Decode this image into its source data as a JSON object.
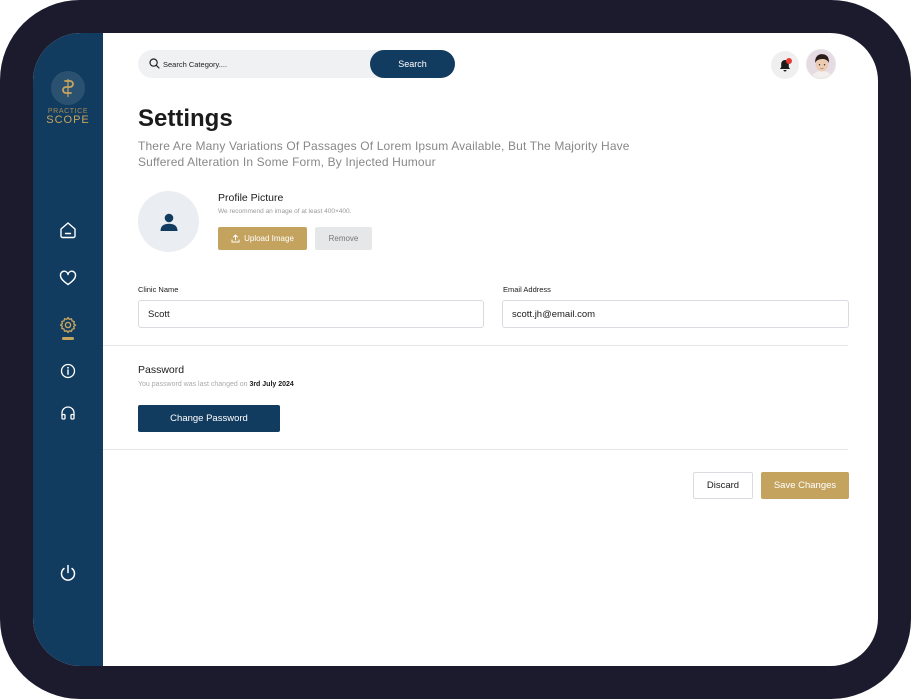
{
  "brand": {
    "line1": "PRACTICE",
    "line2": "SCOPE"
  },
  "sidebar": {
    "items": [
      {
        "name": "home",
        "icon": "home-icon"
      },
      {
        "name": "favorites",
        "icon": "heart-icon"
      },
      {
        "name": "settings",
        "icon": "gear-icon",
        "active": true
      },
      {
        "name": "info",
        "icon": "info-icon"
      },
      {
        "name": "support",
        "icon": "headphones-icon"
      }
    ],
    "logout_icon": "power-icon"
  },
  "header": {
    "search_placeholder": "Search Category....",
    "search_button": "Search",
    "notification_icon": "bell-icon"
  },
  "page": {
    "title": "Settings",
    "subtitle": "There Are Many Variations Of Passages Of Lorem Ipsum Available, But The Majority Have Suffered Alteration In Some Form, By Injected Humour"
  },
  "profile_picture": {
    "title": "Profile Picture",
    "hint": "We recommend an image of at least 400×400.",
    "upload_label": "Upload Image",
    "remove_label": "Remove"
  },
  "form": {
    "clinic_name_label": "Clinic Name",
    "clinic_name_value": "Scott",
    "email_label": "Email Address",
    "email_value": "scott.jh@email.com"
  },
  "password": {
    "title": "Password",
    "hint_prefix": "You password was last changed on",
    "last_changed": "3rd July 2024",
    "change_label": "Change Password"
  },
  "actions": {
    "discard_label": "Discard",
    "save_label": "Save Changes"
  },
  "colors": {
    "frame": "#1c1b2e",
    "sidebar": "#123c5f",
    "accent_gold": "#c4a35f",
    "primary_navy": "#123c5f",
    "notification_dot": "#e53935"
  }
}
